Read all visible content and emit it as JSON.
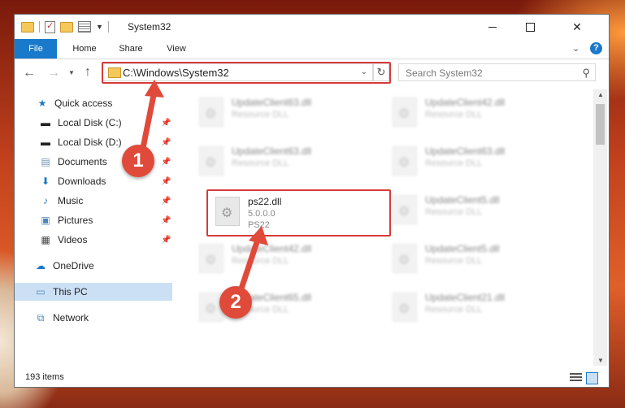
{
  "window": {
    "title": "System32",
    "tabs": {
      "file": "File",
      "home": "Home",
      "share": "Share",
      "view": "View"
    },
    "help": "?"
  },
  "nav": {
    "address": "C:\\Windows\\System32",
    "search_placeholder": "Search System32"
  },
  "sidebar": {
    "items": [
      {
        "label": "Quick access",
        "icon": "star-icon",
        "pinned": false
      },
      {
        "label": "Local Disk (C:)",
        "icon": "drive-icon",
        "pinned": true
      },
      {
        "label": "Local Disk (D:)",
        "icon": "drive-icon",
        "pinned": true
      },
      {
        "label": "Documents",
        "icon": "documents-icon",
        "pinned": true
      },
      {
        "label": "Downloads",
        "icon": "download-icon",
        "pinned": true
      },
      {
        "label": "Music",
        "icon": "music-icon",
        "pinned": true
      },
      {
        "label": "Pictures",
        "icon": "pictures-icon",
        "pinned": true
      },
      {
        "label": "Videos",
        "icon": "videos-icon",
        "pinned": true
      },
      {
        "label": "OneDrive",
        "icon": "cloud-icon",
        "pinned": false
      },
      {
        "label": "This PC",
        "icon": "computer-icon",
        "pinned": false,
        "selected": true
      },
      {
        "label": "Network",
        "icon": "network-icon",
        "pinned": false
      }
    ]
  },
  "files": [
    {
      "name": "UpdateClient63.dll",
      "desc": "Resource DLL"
    },
    {
      "name": "UpdateClient42.dll",
      "desc": "Resource DLL"
    },
    {
      "name": "UpdateClient63.dll",
      "desc": "Resource DLL"
    },
    {
      "name": "UpdateClient63.dll",
      "desc": "Resource DLL"
    },
    {
      "name": "ps22.dll",
      "version": "5.0.0.0",
      "desc": "PS22"
    },
    {
      "name": "UpdateClient5.dll",
      "desc": "Resource DLL"
    },
    {
      "name": "UpdateClient42.dll",
      "desc": "Resource DLL"
    },
    {
      "name": "UpdateClient5.dll",
      "desc": "Resource DLL"
    },
    {
      "name": "UpdateClient65.dll",
      "desc": "Resource DLL"
    },
    {
      "name": "UpdateClient21.dll",
      "desc": "Resource DLL"
    }
  ],
  "status": {
    "item_count": "193 items"
  },
  "callouts": {
    "one": "1",
    "two": "2"
  },
  "colors": {
    "accent": "#1979ca",
    "highlight": "#d83b3b",
    "callout": "#e04a3a",
    "selected": "#cce0f5"
  }
}
